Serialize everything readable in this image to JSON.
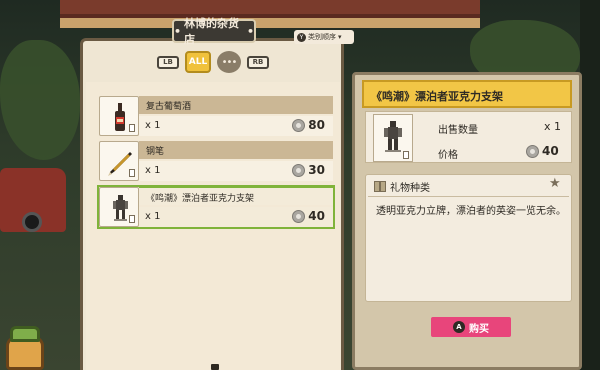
{
  "shop": {
    "title": "林博的杂货店",
    "title_bullet": "•",
    "sort_key": "Y",
    "sort_label": "类别顺序",
    "sort_arrow": "▾",
    "tabs": {
      "lb": "LB",
      "all": "ALL",
      "misc": "•••",
      "rb": "RB"
    },
    "items": [
      {
        "name": "复古葡萄酒",
        "qty": "x 1",
        "price": "80"
      },
      {
        "name": "钢笔",
        "qty": "x 1",
        "price": "30"
      },
      {
        "name": "《鸣潮》漂泊者亚克力支架",
        "qty": "x 1",
        "price": "40"
      }
    ]
  },
  "detail": {
    "title": "《鸣潮》漂泊者亚克力支架",
    "sell_qty_label": "出售数量",
    "sell_qty_value": "x 1",
    "price_label": "价格",
    "price_value": "40",
    "gift_label": "礼物种类",
    "description": "透明亚克力立牌，漂泊者的英姿一览无余。",
    "buy_key": "A",
    "buy_label": "购买"
  },
  "colors": {
    "accent_yellow": "#f2c646",
    "buy_pink": "#e8457b",
    "select_green": "#7fb33a"
  }
}
